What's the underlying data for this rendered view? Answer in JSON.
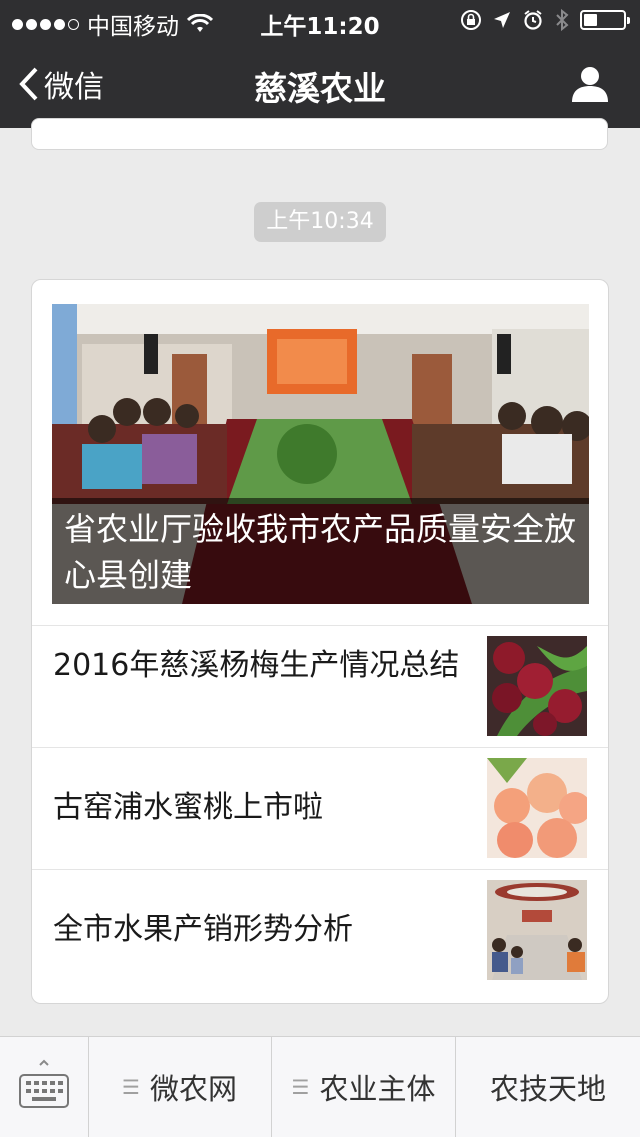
{
  "status_bar": {
    "carrier": "中国移动",
    "time": "上午11:20",
    "battery_level": 0.35
  },
  "nav": {
    "back_label": "微信",
    "title": "慈溪农业"
  },
  "chat": {
    "timestamp": "上午10:34"
  },
  "article": {
    "hero_title": "省农业厅验收我市农产品质量安全放心县创建",
    "items": [
      {
        "title": "2016年慈溪杨梅生产情况总结",
        "thumb": "bayberry"
      },
      {
        "title": "古窑浦水蜜桃上市啦",
        "thumb": "peach"
      },
      {
        "title": "全市水果产销形势分析",
        "thumb": "meeting"
      }
    ]
  },
  "bottom_menu": {
    "items": [
      "微农网",
      "农业主体",
      "农技天地"
    ]
  }
}
